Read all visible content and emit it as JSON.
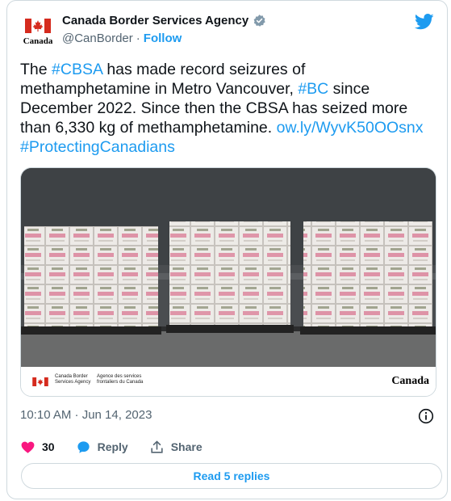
{
  "account": {
    "display_name": "Canada Border Services Agency",
    "handle": "@CanBorder",
    "separator": "·",
    "follow_label": "Follow",
    "logo_wordmark": "Canada"
  },
  "tweet": {
    "t1": "The ",
    "tag_cbsa": "#CBSA",
    "t2": " has made record seizures of methamphetamine in Metro Vancouver, ",
    "tag_bc": "#BC",
    "t3": " since December 2022. Since then the CBSA has seized more than 6,330 kg of methamphetamine. ",
    "link": "ow.ly/WyvK50OOsnx",
    "t4": " ",
    "tag_pc": "#ProtectingCanadians"
  },
  "media": {
    "footer_en": "Canada Border\nServices Agency",
    "footer_fr": "Agence des services\nfrontaliers du Canada",
    "footer_wordmark": "Canada"
  },
  "meta": {
    "timestamp": "10:10 AM · Jun 14, 2023"
  },
  "actions": {
    "like_count": "30",
    "reply_label": "Reply",
    "share_label": "Share"
  },
  "read_replies_label": "Read 5 replies",
  "colors": {
    "accent": "#1d9bf0",
    "like": "#f91880",
    "muted": "#536471",
    "border": "#cfd9de",
    "flag_red": "#d52b1e"
  },
  "icons": [
    "canada-flag-icon",
    "verified-badge-icon",
    "twitter-bird-icon",
    "info-icon",
    "heart-icon",
    "reply-bubble-icon",
    "share-icon"
  ]
}
